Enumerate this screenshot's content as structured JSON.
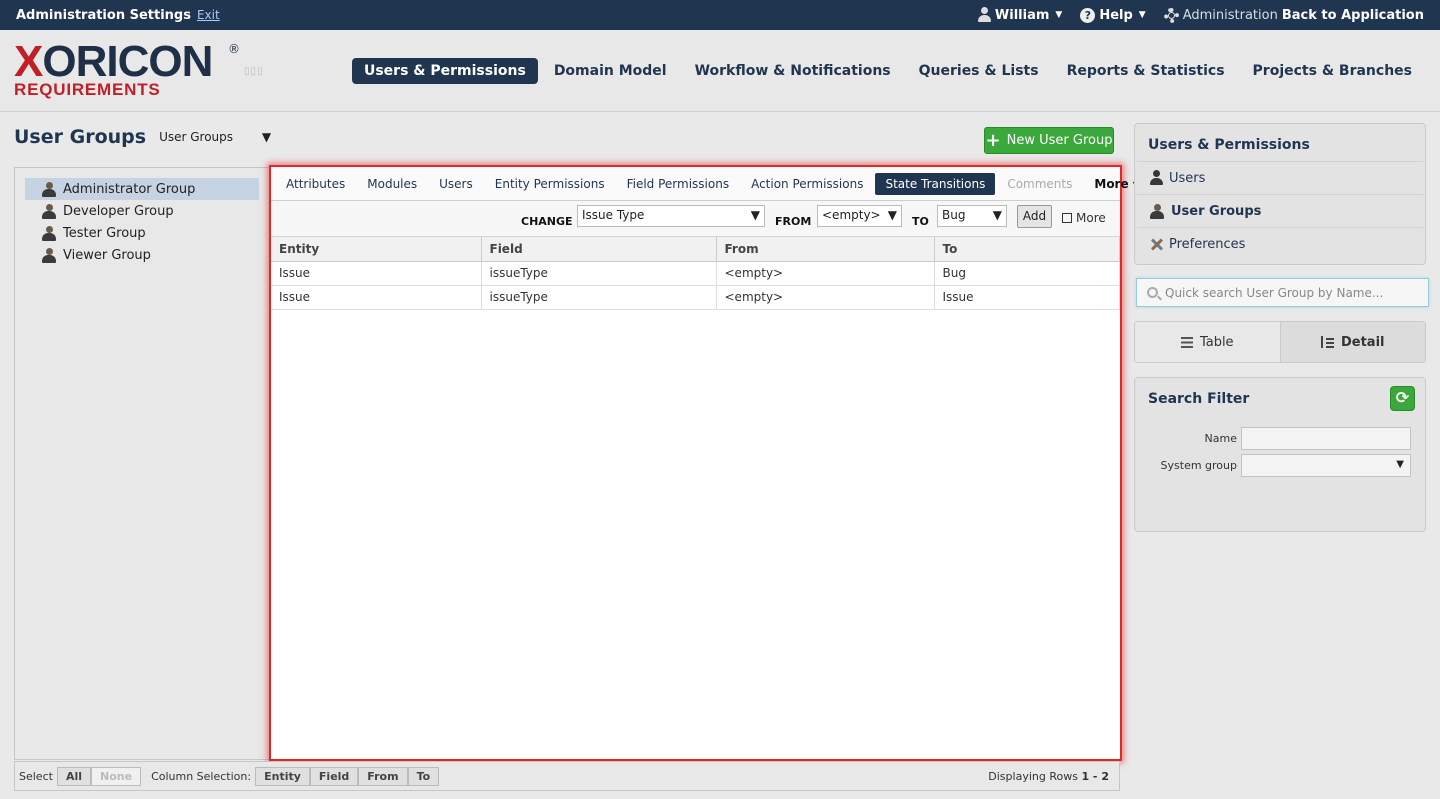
{
  "topbar": {
    "title": "Administration Settings",
    "exit": "Exit",
    "user": "William",
    "help": "Help",
    "admin_label": "Administration",
    "back": "Back to Application"
  },
  "logo": {
    "brand_x": "X",
    "brand_rest": "ORICON",
    "registered": "®",
    "sub": "REQUIREMENTS"
  },
  "mainnav": [
    {
      "label": "Users & Permissions",
      "active": true
    },
    {
      "label": "Domain Model"
    },
    {
      "label": "Workflow & Notifications"
    },
    {
      "label": "Queries & Lists"
    },
    {
      "label": "Reports & Statistics"
    },
    {
      "label": "Projects & Branches"
    }
  ],
  "page": {
    "title": "User Groups",
    "view_select": "User Groups",
    "new_button": "New User Group"
  },
  "groups": [
    {
      "name": "Administrator Group",
      "selected": true
    },
    {
      "name": "Developer Group"
    },
    {
      "name": "Tester Group"
    },
    {
      "name": "Viewer Group"
    }
  ],
  "tabs": [
    {
      "label": "Attributes"
    },
    {
      "label": "Modules"
    },
    {
      "label": "Users"
    },
    {
      "label": "Entity Permissions"
    },
    {
      "label": "Field Permissions"
    },
    {
      "label": "Action Permissions"
    },
    {
      "label": "State Transitions",
      "active": true
    },
    {
      "label": "Comments",
      "disabled": true
    },
    {
      "label": "More ▾"
    }
  ],
  "toolbar": {
    "change_label": "CHANGE",
    "change_value": "Issue Type",
    "from_label": "FROM",
    "from_value": "<empty>",
    "to_label": "TO",
    "to_value": "Bug",
    "add": "Add",
    "more": "More"
  },
  "table": {
    "columns": [
      "Entity",
      "Field",
      "From",
      "To"
    ],
    "rows": [
      [
        "Issue",
        "issueType",
        "<empty>",
        "Bug"
      ],
      [
        "Issue",
        "issueType",
        "<empty>",
        "Issue"
      ]
    ]
  },
  "bottombar": {
    "select_label": "Select",
    "all": "All",
    "none": "None",
    "colsel_label": "Column Selection:",
    "cols": [
      "Entity",
      "Field",
      "From",
      "To"
    ],
    "display_text": "Displaying Rows",
    "display_range": "1 - 2"
  },
  "sidebar": {
    "title": "Users & Permissions",
    "items": [
      {
        "label": "Users"
      },
      {
        "label": "User Groups",
        "active": true
      },
      {
        "label": "Preferences"
      }
    ]
  },
  "quicksearch": {
    "placeholder": "Quick search User Group by Name..."
  },
  "view_switch": {
    "table": "Table",
    "detail": "Detail"
  },
  "search_filter": {
    "title": "Search Filter",
    "name_label": "Name",
    "system_group_label": "System group"
  }
}
